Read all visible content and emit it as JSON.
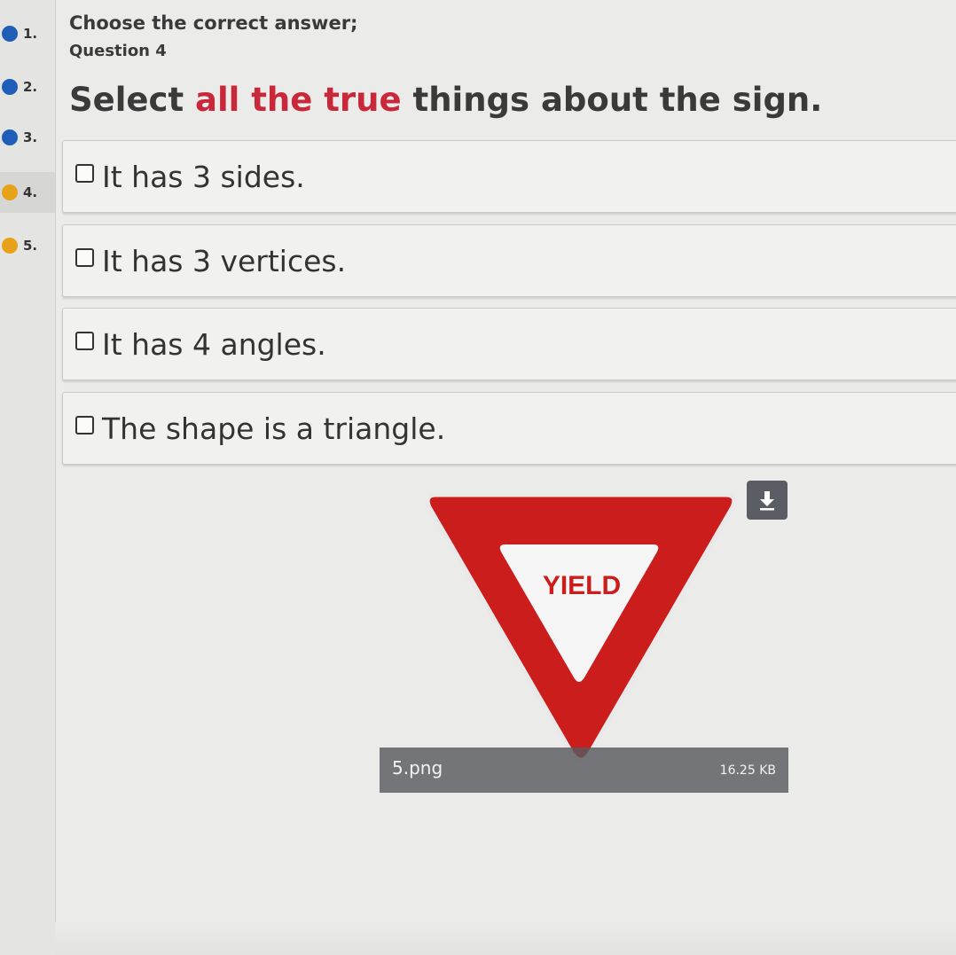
{
  "nav": {
    "items": [
      {
        "label": "1.",
        "status_color": "#1e5db8"
      },
      {
        "label": "2.",
        "status_color": "#1e5db8"
      },
      {
        "label": "3.",
        "status_color": "#1e5db8"
      },
      {
        "label": "4.",
        "status_color": "#e8a21a"
      },
      {
        "label": "5.",
        "status_color": "#e8a21a"
      }
    ],
    "current_index": 3
  },
  "question": {
    "instruction": "Choose the correct answer;",
    "number_label": "Question 4",
    "prompt_before": "Select ",
    "prompt_highlight": "all the true",
    "prompt_after": " things about the sign.",
    "highlight_color": "#c8283a"
  },
  "options": [
    {
      "label": "It has 3 sides.",
      "checked": false
    },
    {
      "label": "It has 3 vertices.",
      "checked": false
    },
    {
      "label": "It has 4 angles.",
      "checked": false
    },
    {
      "label": "The shape is a triangle.",
      "checked": false
    }
  ],
  "attachment": {
    "sign_text": "YIELD",
    "sign_color": "#cc1d1d",
    "file_name": "5.png",
    "file_size": "16.25 KB",
    "download_icon": "download-icon"
  }
}
